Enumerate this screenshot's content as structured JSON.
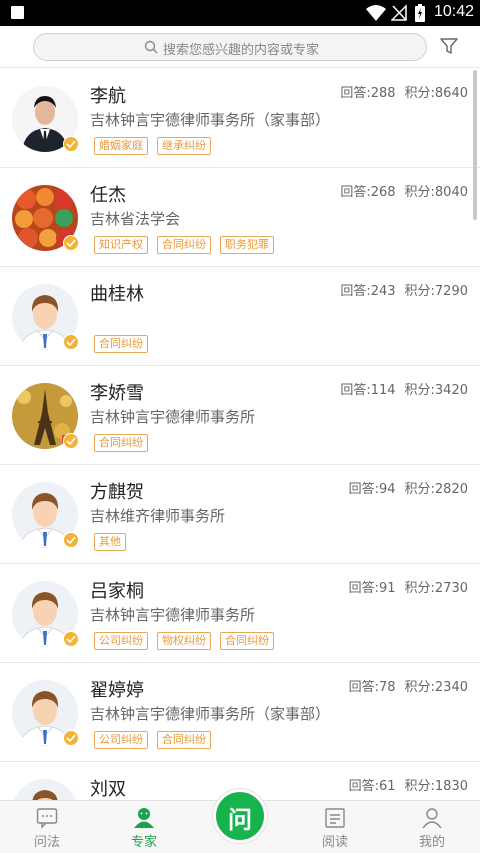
{
  "status_bar": {
    "time": "10:42"
  },
  "search": {
    "placeholder": "搜索您感兴趣的内容或专家"
  },
  "experts": [
    {
      "name": "李航",
      "org": "吉林钟言宇德律师事务所（家事部）",
      "answers": "回答:288",
      "points": "积分:8640",
      "tags": [
        "婚姻家庭",
        "继承纠纷"
      ],
      "avatar": "photo-man-suit"
    },
    {
      "name": "任杰",
      "org": "吉林省法学会",
      "answers": "回答:268",
      "points": "积分:8040",
      "tags": [
        "知识产权",
        "合同纠纷",
        "职务犯罪"
      ],
      "avatar": "photo-fruit"
    },
    {
      "name": "曲桂林",
      "org": "",
      "answers": "回答:243",
      "points": "积分:7290",
      "tags": [
        "合同纠纷"
      ],
      "avatar": "default-man"
    },
    {
      "name": "李娇雪",
      "org": "吉林钟言宇德律师事务所",
      "answers": "回答:114",
      "points": "积分:3420",
      "tags": [
        "合同纠纷"
      ],
      "avatar": "photo-eiffel"
    },
    {
      "name": "方麒贺",
      "org": "吉林维齐律师事务所",
      "answers": "回答:94",
      "points": "积分:2820",
      "tags": [
        "其他"
      ],
      "avatar": "default-man"
    },
    {
      "name": "吕家桐",
      "org": "吉林钟言宇德律师事务所",
      "answers": "回答:91",
      "points": "积分:2730",
      "tags": [
        "公司纠纷",
        "物权纠纷",
        "合同纠纷"
      ],
      "avatar": "default-man"
    },
    {
      "name": "翟婷婷",
      "org": "吉林钟言宇德律师事务所（家事部）",
      "answers": "回答:78",
      "points": "积分:2340",
      "tags": [
        "公司纠纷",
        "合同纠纷"
      ],
      "avatar": "default-man"
    },
    {
      "name": "刘双",
      "org": "",
      "answers": "回答:61",
      "points": "积分:1830",
      "tags": [],
      "avatar": "default-man"
    }
  ],
  "nav": {
    "items": [
      {
        "label": "问法",
        "icon": "chat-icon"
      },
      {
        "label": "专家",
        "icon": "expert-icon"
      },
      {
        "label": "问",
        "icon": "ask-icon"
      },
      {
        "label": "阅读",
        "icon": "read-icon"
      },
      {
        "label": "我的",
        "icon": "profile-icon"
      }
    ],
    "active_color": "#1aa24a"
  }
}
